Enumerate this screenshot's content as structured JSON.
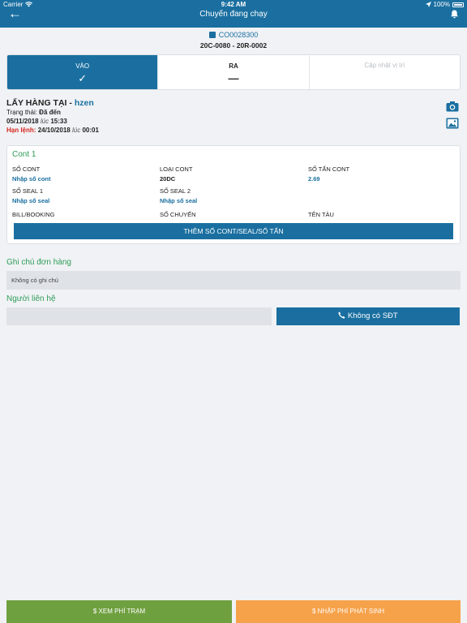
{
  "status_bar": {
    "carrier": "Carrier",
    "time": "9:42 AM",
    "battery": "100%"
  },
  "nav": {
    "title": "Chuyến đang chạy"
  },
  "trip": {
    "code": "CO0028300",
    "plates": "20C-0080 - 20R-0002"
  },
  "tabs": [
    {
      "label": "VÀO",
      "mark": "✓",
      "state": "active"
    },
    {
      "label": "RA",
      "mark": "—",
      "state": "normal"
    },
    {
      "label": "Cập nhật vị trí",
      "mark": "",
      "state": "disabled"
    }
  ],
  "pickup": {
    "heading_prefix": "LẤY HÀNG TẠI - ",
    "location": "hzen",
    "status_label": "Trạng thái: ",
    "status_value": "Đã đến",
    "arrival_date": "05/11/2018",
    "at_label": "lúc",
    "arrival_time": "15:33",
    "deadline_label": "Hạn lệnh:",
    "deadline_date": "24/10/2018",
    "deadline_time": "00:01"
  },
  "container": {
    "title": "Cont 1",
    "fields": {
      "cont_no_label": "SỐ CONT",
      "cont_no_value": "Nhập số cont",
      "cont_type_label": "LOẠI CONT",
      "cont_type_value": "20DC",
      "tons_label": "SỐ TẤN CONT",
      "tons_value": "2.69",
      "seal1_label": "SỐ SEAL 1",
      "seal1_value": "Nhập số seal",
      "seal2_label": "SỐ SEAL 2",
      "seal2_value": "Nhập số seal",
      "bill_label": "BILL/BOOKING",
      "voyage_label": "SỐ CHUYẾN",
      "vessel_label": "TÊN TÀU"
    },
    "add_button": "THÊM SỐ CONT/SEAL/SỐ TẤN"
  },
  "notes": {
    "title": "Ghi chú đơn hàng",
    "value": "Không có ghi chú"
  },
  "contact": {
    "title": "Người liên hệ",
    "name_value": "",
    "phone_button": "Không có SĐT"
  },
  "bottom": {
    "view_fee": "$ XEM PHÍ TRẠM",
    "extra_fee": "$ NHẬP PHÍ PHÁT SINH"
  },
  "colors": {
    "primary": "#1a6fa0",
    "green": "#2e9c57",
    "warning": "#d9251c",
    "fee_button": "#6fa040",
    "extra_button": "#f6a24a"
  }
}
